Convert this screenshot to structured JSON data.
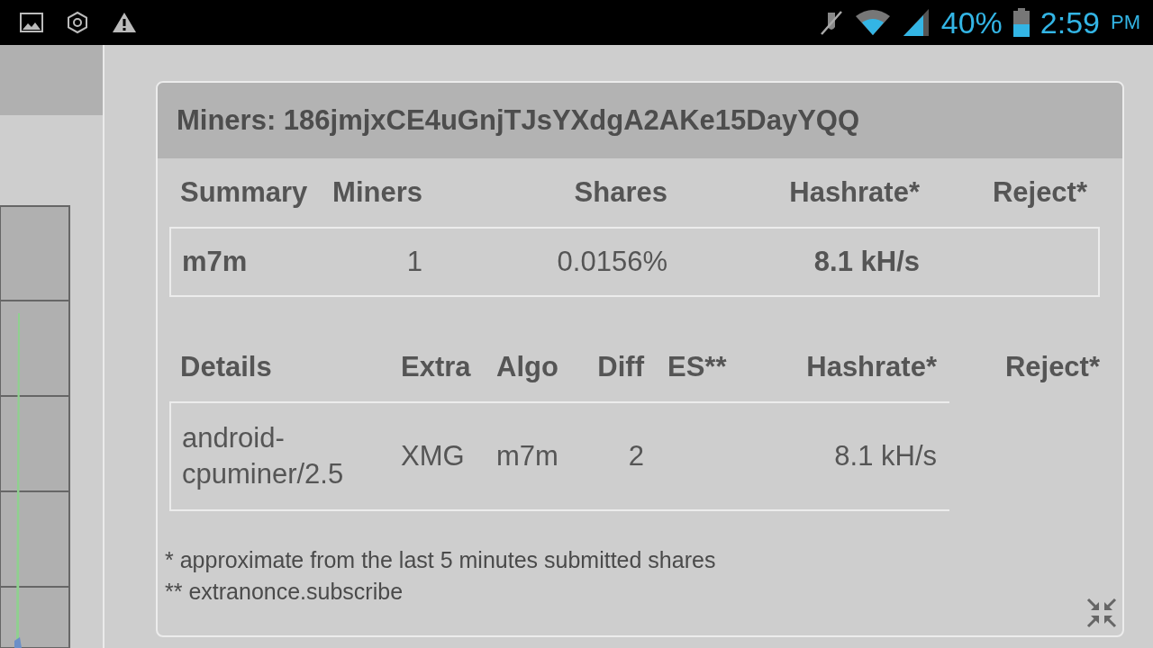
{
  "status_bar": {
    "battery": "40%",
    "time": "2:59",
    "ampm": "PM"
  },
  "panel": {
    "title": "Miners: 186jmjxCE4uGnjTJsYXdgA2AKe15DayYQQ",
    "summary": {
      "columns": [
        "Summary",
        "Miners",
        "Shares",
        "Hashrate*",
        "Reject*"
      ],
      "rows": [
        {
          "cells": [
            "m7m",
            "1",
            "0.0156%",
            "8.1 kH/s"
          ]
        }
      ]
    },
    "details": {
      "columns": [
        "Details",
        "Extra",
        "Algo",
        "Diff",
        "ES**",
        "Hashrate*",
        "Reject*"
      ],
      "rows": [
        {
          "cells": [
            "android-cpuminer/2.5",
            "XMG",
            "m7m",
            "2",
            null,
            "8.1 kH/s"
          ]
        }
      ]
    },
    "footnotes": [
      "* approximate from the last 5 minutes submitted shares",
      "** extranonce.subscribe"
    ]
  }
}
